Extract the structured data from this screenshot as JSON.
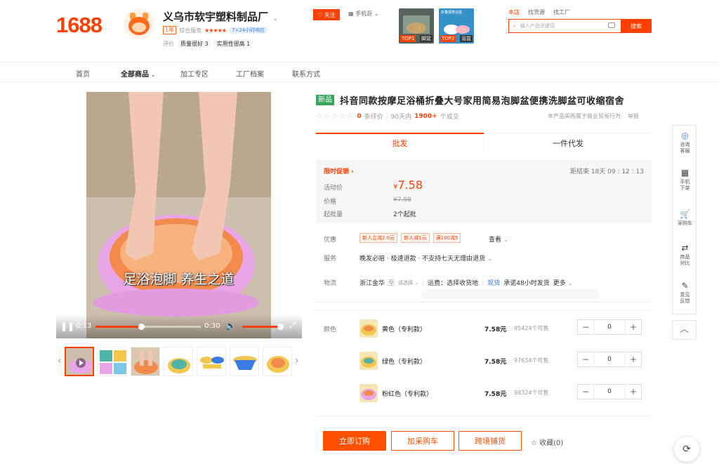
{
  "brand": {
    "logo": "1688"
  },
  "shop": {
    "name": "义乌市软宇塑料制品厂",
    "years": "1年",
    "service_label": "综合服务",
    "service_stars": "★★★★★",
    "reply_badge": "7×24小时响应",
    "eval_label": "评价",
    "tag1": "质量很好 3",
    "tag2": "实用性很高 1"
  },
  "header": {
    "follow": "关注",
    "mobile": "手机逛",
    "promo1_tag": "TOP1",
    "promo1_cat": "脚盆",
    "promo2_tag": "TOP2",
    "promo2_cat": "浴盆",
    "promo2_caption": "折叠便携浴盆",
    "scope_this_shop": "本店",
    "scope_find_goods": "找货源",
    "scope_find_factory": "找工厂",
    "search_placeholder": "输入产品关键词",
    "search_button": "搜索"
  },
  "nav": {
    "home": "首页",
    "all": "全部商品",
    "oem": "加工专区",
    "factory": "工厂档案",
    "contact": "联系方式"
  },
  "video": {
    "caption": "足浴泡脚 养生之道",
    "elapsed": "0:13",
    "duration": "0:30",
    "progress": 0.44,
    "volume": 1.0
  },
  "product": {
    "new_tag": "新品",
    "title": "抖音同款按摩足浴桶折叠大号家用简易泡脚盆便携洗脚盆可收缩宿舍",
    "rating_stars": "☆☆☆☆☆",
    "reviews_count": "0",
    "reviews_label": "条评价",
    "sold_prefix": "90天内",
    "sold_count": "1900+",
    "sold_suffix": "个成交",
    "purchase_note": "本产品采购属于商业贸易行为",
    "report": "举报"
  },
  "tabs": {
    "wholesale": "批发",
    "dropship": "一件代发"
  },
  "price": {
    "flash_label": "限时促销",
    "countdown": "距结束 18天 09 : 12 : 13",
    "promo_label": "活动价",
    "currency": "¥",
    "promo_price": "7.58",
    "orig_label": "价格",
    "orig_price": "¥7.98",
    "moq_label": "起批量",
    "moq_value": "2个起批"
  },
  "offers": {
    "discount_label": "优惠",
    "coupons": [
      "新人立减2.0元",
      "新人减1元",
      "满100减5"
    ],
    "view": "查看",
    "service_label": "服务",
    "service_text": "晚发必赔 · 极速退款 · 不支持七天无理由退货",
    "logistics_label": "物流",
    "origin": "浙江金华",
    "to": "至",
    "destination": "请选择",
    "freight": "运费：选择收货地",
    "in_stock": "现货",
    "ship_promise": "承诺48小时发货",
    "more": "更多"
  },
  "sku": {
    "color_label": "颜色",
    "items": [
      {
        "name": "黄色（专利款）",
        "price": "7.58元",
        "stock": "95424个可售",
        "qty": "0"
      },
      {
        "name": "绿色（专利款）",
        "price": "7.58元",
        "stock": "97634个可售",
        "qty": "0"
      },
      {
        "name": "粉红色（专利款）",
        "price": "7.58元",
        "stock": "98324个可售",
        "qty": "0"
      }
    ]
  },
  "actions": {
    "order": "立即订购",
    "cart": "加采购车",
    "cross": "跨境铺货",
    "fav": "收藏(0)"
  },
  "sidebar": [
    {
      "icon": "chat-icon",
      "label": "咨询\n客服"
    },
    {
      "icon": "qr-icon",
      "label": "手机\n下单"
    },
    {
      "icon": "cart-icon",
      "label": "采购车"
    },
    {
      "icon": "compare-icon",
      "label": "商品\n对比"
    },
    {
      "icon": "edit-icon",
      "label": "意见\n反馈"
    }
  ],
  "colors": {
    "accent": "#ff4000",
    "green": "#38a55c",
    "pink": "#e9a6e6"
  }
}
